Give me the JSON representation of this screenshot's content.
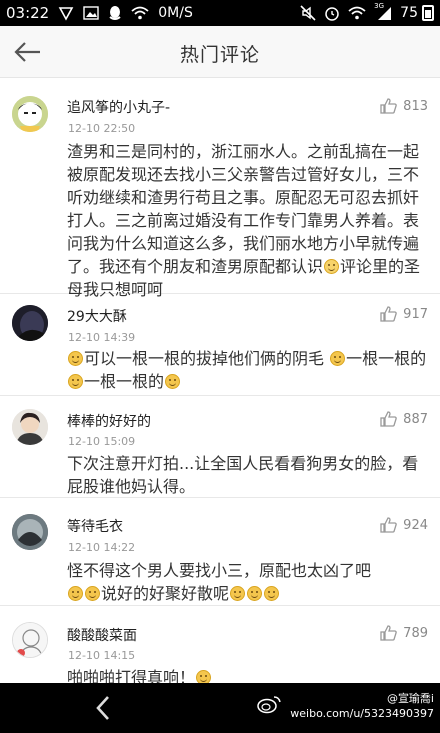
{
  "status_bar": {
    "time": "03:22",
    "network_speed": "0M/S",
    "signal_label": "3G",
    "battery": "75"
  },
  "header": {
    "title": "热门评论"
  },
  "comments": [
    {
      "name": "追风筝的小丸子-",
      "time": "12-10 22:50",
      "likes": "813",
      "text": "渣男和三是同村的，浙江丽水人。之前乱搞在一起被原配发现还去找小三父亲警告过管好女儿，三不听劝继续和渣男行苟且之事。原配忍无可忍去抓奸打人。三之前离过婚没有工作专门靠男人养着。表问我为什么知道这么多，我们丽水地方小早就传遍了。我还有个朋友和渣男原配都认识",
      "text_after_emoji": "评论里的圣母我只想呵呵"
    },
    {
      "name": "29大大酥",
      "time": "12-10 14:39",
      "likes": "917",
      "text_parts": [
        "可以一根一根的拔掉他们俩的阴毛",
        "一根一根的",
        "一根一根的"
      ]
    },
    {
      "name": "棒棒的好好的",
      "time": "12-10 15:09",
      "likes": "887",
      "text": "下次注意开灯拍...让全国人民看看狗男女的脸，看屁股谁他妈认得。"
    },
    {
      "name": "等待毛衣",
      "time": "12-10 14:22",
      "likes": "924",
      "text": "怪不得这个男人要找小三，原配也太凶了吧",
      "text_line2": "说好的好聚好散呢"
    },
    {
      "name": "酸酸酸菜面",
      "time": "12-10 14:15",
      "likes": "789",
      "text": "啪啪啪打得真响！"
    }
  ],
  "watermark": {
    "author": "@宣瑜喬i",
    "url": "weibo.com/u/5323490397"
  },
  "colors": {
    "status_bar_bg": "#000000",
    "header_bg": "#f8f8f8",
    "text": "#333333",
    "meta": "#999999",
    "like_icon": "#9a9a9a"
  },
  "icons": [
    "back-arrow-icon",
    "thumbs-up-icon",
    "smiley-emoji-icon",
    "wifi-icon",
    "battery-icon",
    "weibo-logo-icon"
  ]
}
